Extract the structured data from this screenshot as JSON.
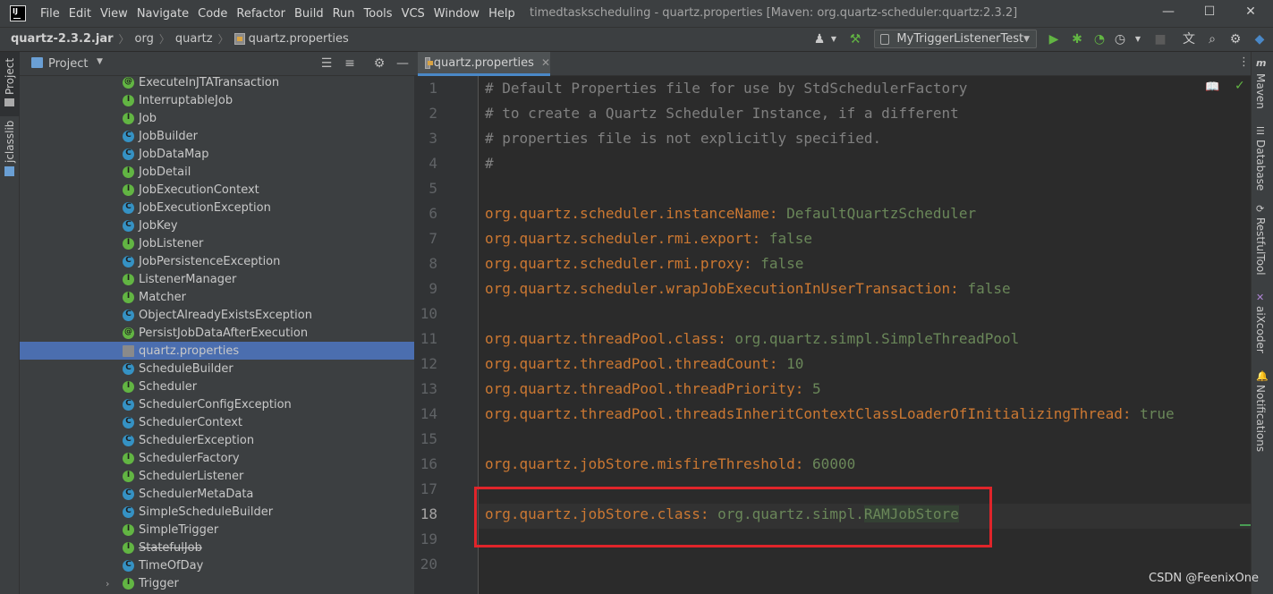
{
  "titlebar": {
    "logo_text": "IJ",
    "menu": [
      "File",
      "Edit",
      "View",
      "Navigate",
      "Code",
      "Refactor",
      "Build",
      "Run",
      "Tools",
      "VCS",
      "Window",
      "Help"
    ],
    "window_title": "timedtaskscheduling - quartz.properties [Maven: org.quartz-scheduler:quartz:2.3.2]",
    "controls": {
      "minimize": "—",
      "maximize": "☐",
      "close": "✕"
    }
  },
  "navbar": {
    "breadcrumb": [
      "quartz-2.3.2.jar",
      "org",
      "quartz",
      "quartz.properties"
    ],
    "run_config": "MyTriggerListenerTest"
  },
  "left_strip": {
    "project_tab": "Project",
    "jclasslib_tab": "jclasslib"
  },
  "project_panel": {
    "title": "Project",
    "items": [
      {
        "label": "ExecuteInJTATransaction",
        "icon": "annotation-icon",
        "glyph": "@"
      },
      {
        "label": "InterruptableJob",
        "icon": "interface-icon",
        "glyph": "I"
      },
      {
        "label": "Job",
        "icon": "interface-icon",
        "glyph": "I"
      },
      {
        "label": "JobBuilder",
        "icon": "class-icon",
        "glyph": "C"
      },
      {
        "label": "JobDataMap",
        "icon": "class-icon",
        "glyph": "C"
      },
      {
        "label": "JobDetail",
        "icon": "interface-icon",
        "glyph": "I"
      },
      {
        "label": "JobExecutionContext",
        "icon": "interface-icon",
        "glyph": "I"
      },
      {
        "label": "JobExecutionException",
        "icon": "class-icon",
        "glyph": "C"
      },
      {
        "label": "JobKey",
        "icon": "class-icon",
        "glyph": "C"
      },
      {
        "label": "JobListener",
        "icon": "interface-icon",
        "glyph": "I"
      },
      {
        "label": "JobPersistenceException",
        "icon": "class-icon",
        "glyph": "C"
      },
      {
        "label": "ListenerManager",
        "icon": "interface-icon",
        "glyph": "I"
      },
      {
        "label": "Matcher",
        "icon": "interface-icon",
        "glyph": "I"
      },
      {
        "label": "ObjectAlreadyExistsException",
        "icon": "class-icon",
        "glyph": "C"
      },
      {
        "label": "PersistJobDataAfterExecution",
        "icon": "annotation-icon",
        "glyph": "@"
      },
      {
        "label": "quartz.properties",
        "icon": "properties-file-icon",
        "glyph": ""
      },
      {
        "label": "ScheduleBuilder",
        "icon": "class-icon",
        "glyph": "C"
      },
      {
        "label": "Scheduler",
        "icon": "interface-icon",
        "glyph": "I"
      },
      {
        "label": "SchedulerConfigException",
        "icon": "class-icon",
        "glyph": "C"
      },
      {
        "label": "SchedulerContext",
        "icon": "class-icon",
        "glyph": "C"
      },
      {
        "label": "SchedulerException",
        "icon": "class-icon",
        "glyph": "C"
      },
      {
        "label": "SchedulerFactory",
        "icon": "interface-icon",
        "glyph": "I"
      },
      {
        "label": "SchedulerListener",
        "icon": "interface-icon",
        "glyph": "I"
      },
      {
        "label": "SchedulerMetaData",
        "icon": "class-icon",
        "glyph": "C"
      },
      {
        "label": "SimpleScheduleBuilder",
        "icon": "class-icon",
        "glyph": "C"
      },
      {
        "label": "SimpleTrigger",
        "icon": "interface-icon",
        "glyph": "I"
      },
      {
        "label": "StatefulJob",
        "icon": "interface-icon",
        "glyph": "I"
      },
      {
        "label": "TimeOfDay",
        "icon": "class-icon",
        "glyph": "C"
      },
      {
        "label": "Trigger",
        "icon": "interface-icon",
        "glyph": "I"
      }
    ],
    "selected_index": 15,
    "struck_index": 26,
    "expandable_index": 28
  },
  "editor": {
    "tab_label": "quartz.properties",
    "current_line": 18,
    "lines": [
      {
        "n": "1",
        "comment": "# Default Properties file for use by StdSchedulerFactory"
      },
      {
        "n": "2",
        "comment": "# to create a Quartz Scheduler Instance, if a different"
      },
      {
        "n": "3",
        "comment": "# properties file is not explicitly specified."
      },
      {
        "n": "4",
        "comment": "#"
      },
      {
        "n": "5"
      },
      {
        "n": "6",
        "key": "org.quartz.scheduler.instanceName",
        "value": "DefaultQuartzScheduler"
      },
      {
        "n": "7",
        "key": "org.quartz.scheduler.rmi.export",
        "value": "false"
      },
      {
        "n": "8",
        "key": "org.quartz.scheduler.rmi.proxy",
        "value": "false"
      },
      {
        "n": "9",
        "key": "org.quartz.scheduler.wrapJobExecutionInUserTransaction",
        "value": "false"
      },
      {
        "n": "10"
      },
      {
        "n": "11",
        "key": "org.quartz.threadPool.class",
        "value": "org.quartz.simpl.SimpleThreadPool"
      },
      {
        "n": "12",
        "key": "org.quartz.threadPool.threadCount",
        "value": "10"
      },
      {
        "n": "13",
        "key": "org.quartz.threadPool.threadPriority",
        "value": "5"
      },
      {
        "n": "14",
        "key": "org.quartz.threadPool.threadsInheritContextClassLoaderOfInitializingThread",
        "value": "true"
      },
      {
        "n": "15"
      },
      {
        "n": "16",
        "key": "org.quartz.jobStore.misfireThreshold",
        "value": "60000"
      },
      {
        "n": "17"
      },
      {
        "n": "18",
        "key": "org.quartz.jobStore.class",
        "value": "org.quartz.simpl.",
        "value_highlight": "RAMJobStore"
      },
      {
        "n": "19"
      },
      {
        "n": "20"
      }
    ],
    "separator": ": "
  },
  "right_strip": {
    "tabs": [
      "Maven",
      "Database",
      "RestfulTool",
      "aiXcoder",
      "Notifications"
    ]
  },
  "watermark": "CSDN @FeenixOne",
  "colors": {
    "accent_selection": "#4b6eaf",
    "property_key": "#cc7832",
    "property_value": "#6a8759",
    "comment": "#808080",
    "annotation_box": "#e0242a",
    "run_green": "#62b543"
  }
}
